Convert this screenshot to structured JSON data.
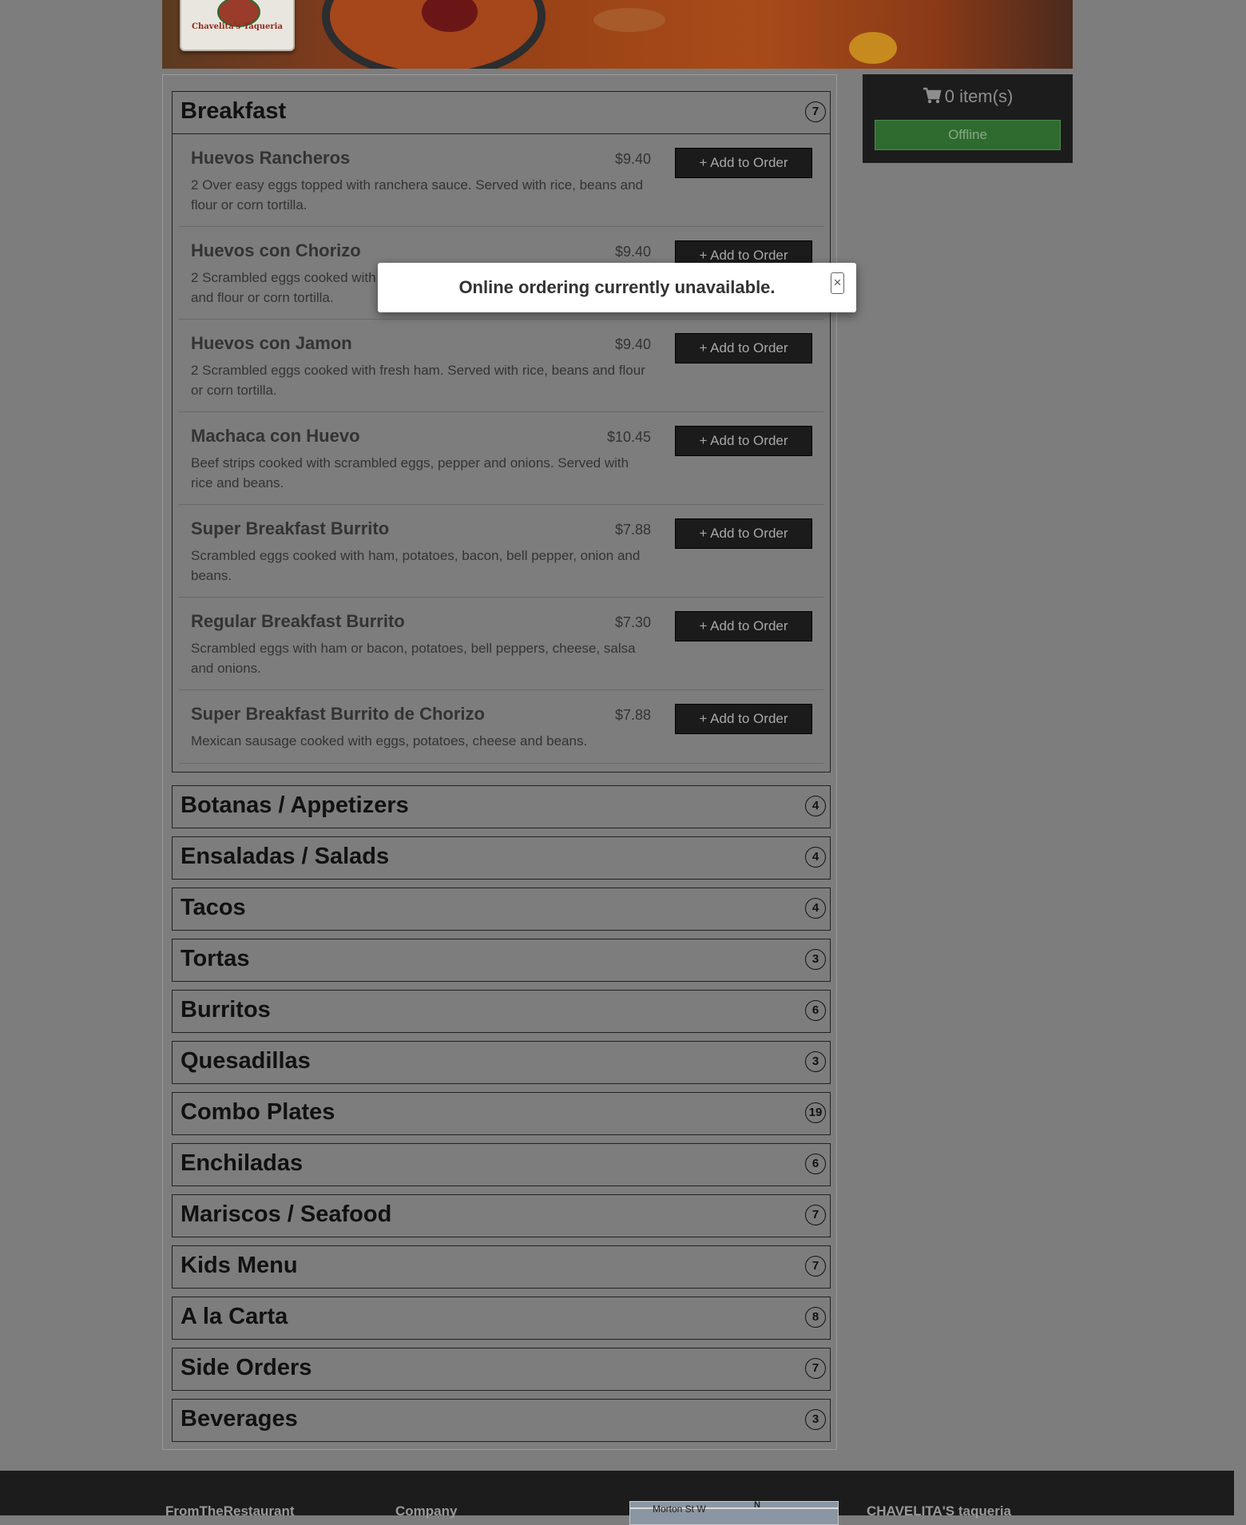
{
  "hero": {
    "logo_text": "Chavelita's Taqueria"
  },
  "cart": {
    "count_label": "0 item(s)",
    "status_label": "Offline"
  },
  "modal": {
    "message": "Online ordering currently unavailable.",
    "close_glyph": "×"
  },
  "menu": {
    "add_label": "+ Add to Order",
    "breakfast": {
      "title": "Breakfast",
      "count": "7",
      "items": [
        {
          "name": "Huevos Rancheros",
          "price": "$9.40",
          "desc": "2 Over easy eggs topped with ranchera sauce. Served with rice, beans and flour or corn tortilla."
        },
        {
          "name": "Huevos con Chorizo",
          "price": "$9.40",
          "desc": "2 Scrambled eggs cooked with Mexican sausage. Served with rice, beans and flour or corn tortilla."
        },
        {
          "name": "Huevos con Jamon",
          "price": "$9.40",
          "desc": "2 Scrambled eggs cooked with fresh ham. Served with rice, beans and flour or corn tortilla."
        },
        {
          "name": "Machaca con Huevo",
          "price": "$10.45",
          "desc": "Beef strips cooked with scrambled eggs, pepper and onions. Served with rice and beans."
        },
        {
          "name": "Super Breakfast Burrito",
          "price": "$7.88",
          "desc": "Scrambled eggs cooked with ham, potatoes, bacon, bell pepper, onion and beans."
        },
        {
          "name": "Regular Breakfast Burrito",
          "price": "$7.30",
          "desc": "Scrambled eggs with ham or bacon, potatoes, bell peppers, cheese, salsa and onions."
        },
        {
          "name": "Super Breakfast Burrito de Chorizo",
          "price": "$7.88",
          "desc": "Mexican sausage cooked with eggs, potatoes, cheese and beans."
        }
      ]
    },
    "categories": [
      {
        "title": "Botanas / Appetizers",
        "count": "4"
      },
      {
        "title": "Ensaladas / Salads",
        "count": "4"
      },
      {
        "title": "Tacos",
        "count": "4"
      },
      {
        "title": "Tortas",
        "count": "3"
      },
      {
        "title": "Burritos",
        "count": "6"
      },
      {
        "title": "Quesadillas",
        "count": "3"
      },
      {
        "title": "Combo Plates",
        "count": "19"
      },
      {
        "title": "Enchiladas",
        "count": "6"
      },
      {
        "title": "Mariscos / Seafood",
        "count": "7"
      },
      {
        "title": "Kids Menu",
        "count": "7"
      },
      {
        "title": "A la Carta",
        "count": "8"
      },
      {
        "title": "Side Orders",
        "count": "7"
      },
      {
        "title": "Beverages",
        "count": "3"
      }
    ]
  },
  "footer": {
    "col1": "FromTheRestaurant",
    "col2": "Company",
    "map_street": "Morton St W",
    "map_north": "N",
    "col4": "CHAVELITA'S taqueria"
  }
}
